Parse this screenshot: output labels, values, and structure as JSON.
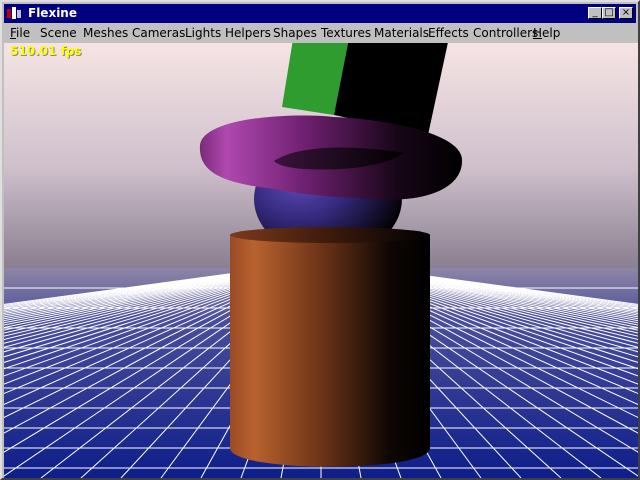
{
  "window": {
    "title": "Flexine",
    "minimize_glyph": "_",
    "maximize_glyph": "□",
    "close_glyph": "×"
  },
  "menu": {
    "items": [
      {
        "label": "File",
        "accel": "F",
        "rest": "ile"
      },
      {
        "label": "Scene"
      },
      {
        "label": "Meshes"
      },
      {
        "label": "Cameras"
      },
      {
        "label": "Lights"
      },
      {
        "label": "Helpers"
      },
      {
        "label": "Shapes"
      },
      {
        "label": "Textures"
      },
      {
        "label": "Materials"
      },
      {
        "label": "Effects"
      },
      {
        "label": "Controllers"
      },
      {
        "label": "Help",
        "accel": "H",
        "rest": "elp"
      }
    ]
  },
  "viewport": {
    "fps_text": "510.01 fps",
    "sky_top": "#f6e4e4",
    "sky_bottom": "#8a7f90",
    "floor_color": "#1e2a88",
    "grid_color": "#ffffff",
    "fps_color": "#ffff00"
  },
  "objects": [
    {
      "name": "green cube",
      "color": "#2e9c2e"
    },
    {
      "name": "purple torus",
      "color": "#8c2e8c"
    },
    {
      "name": "blue sphere",
      "color": "#4a3a9c"
    },
    {
      "name": "brown cylinder",
      "color": "#b85a2e"
    }
  ]
}
